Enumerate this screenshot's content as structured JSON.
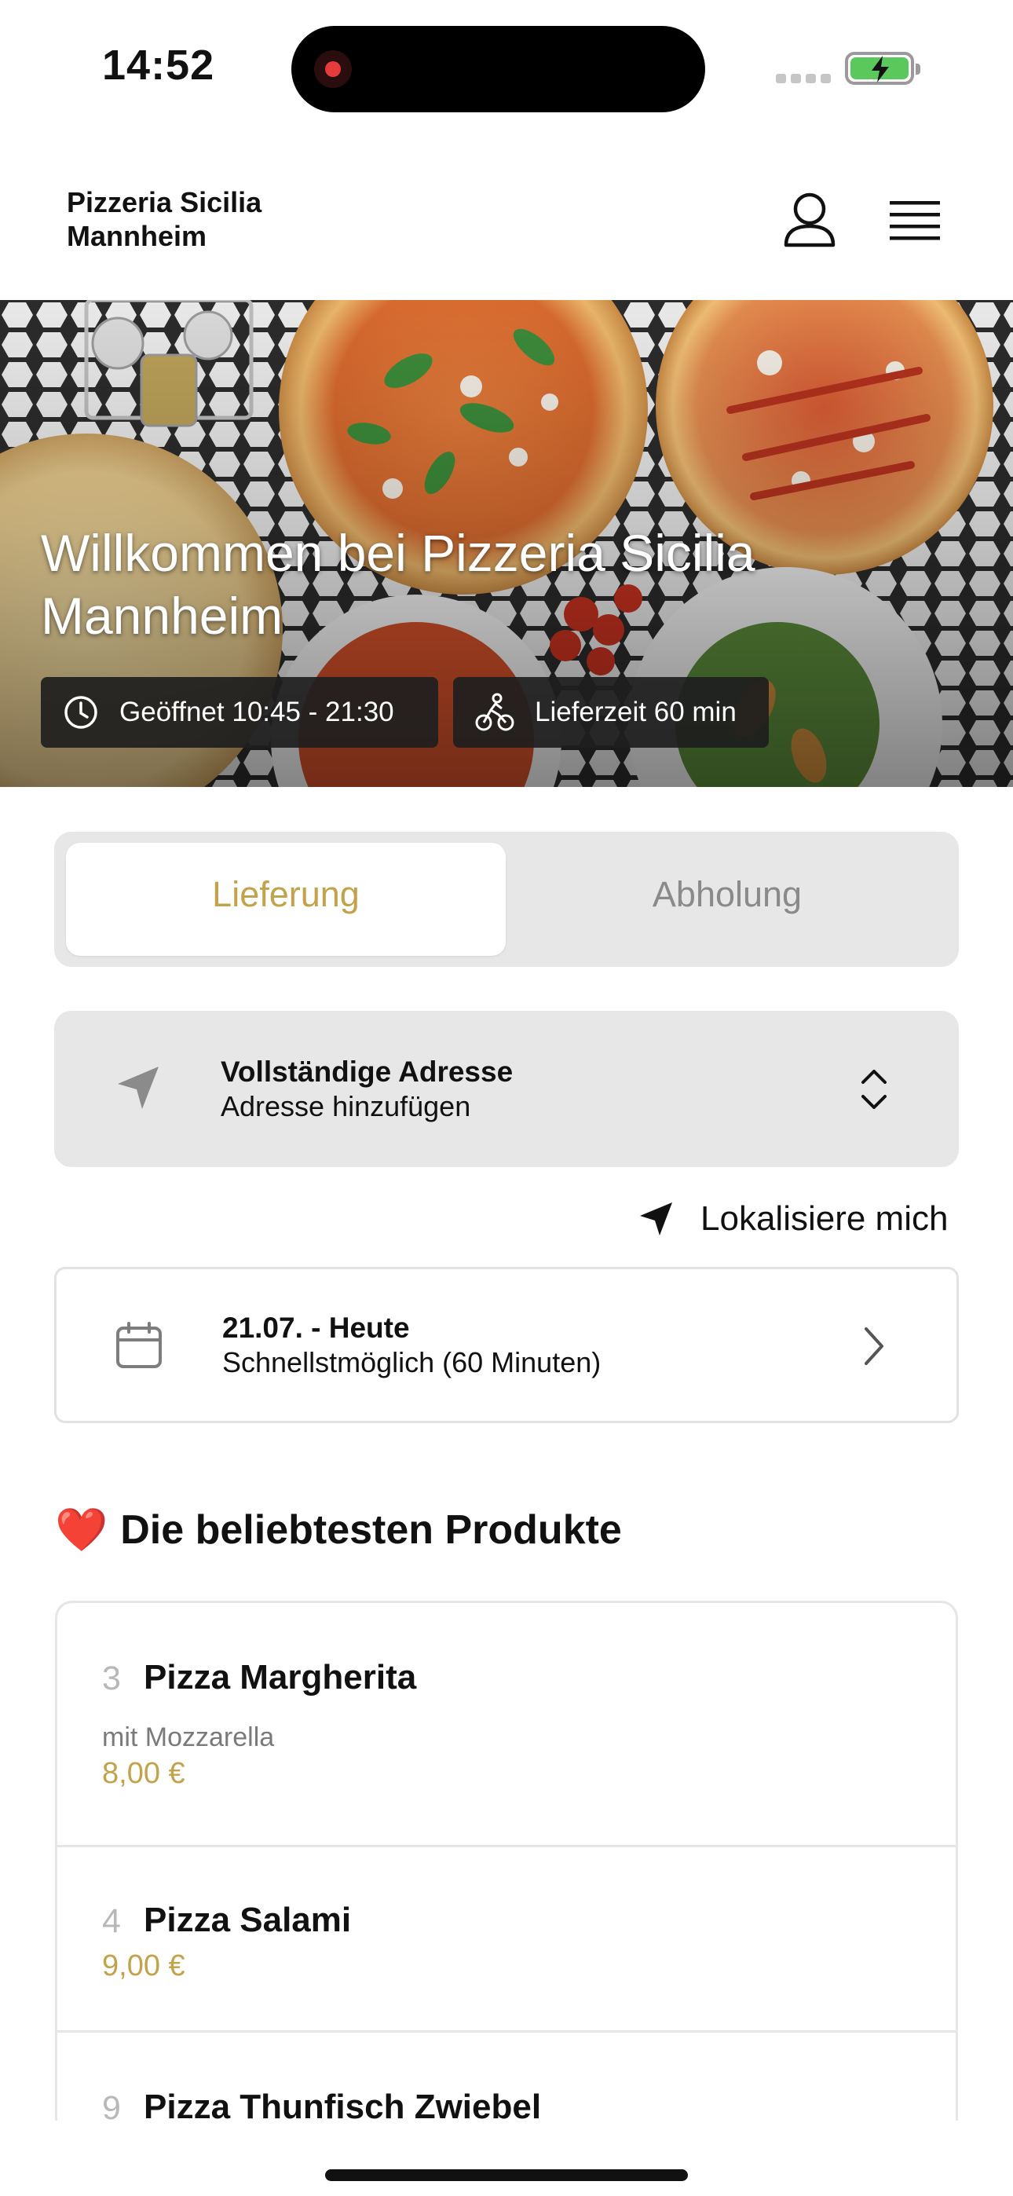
{
  "status_bar": {
    "time": "14:52"
  },
  "header": {
    "brand_line1": "Pizzeria Sicilia",
    "brand_line2": "Mannheim"
  },
  "hero": {
    "title": "Willkommen bei Pizzeria Sicilia Mannheim",
    "open_chip": "Geöffnet 10:45 - 21:30",
    "delivery_chip": "Lieferzeit 60 min"
  },
  "mode_toggle": {
    "delivery": "Lieferung",
    "pickup": "Abholung",
    "selected": "delivery"
  },
  "address": {
    "title": "Vollständige Adresse",
    "subtitle": "Adresse hinzufügen"
  },
  "locate_me": "Lokalisiere mich",
  "schedule": {
    "title": "21.07. - Heute",
    "subtitle": "Schnellstmöglich (60 Minuten)"
  },
  "popular": {
    "heading_emoji": "❤️",
    "heading": "Die beliebtesten Produkte",
    "items": [
      {
        "number": "3",
        "name": "Pizza Margherita",
        "description": "mit Mozzarella",
        "price": "8,00 €"
      },
      {
        "number": "4",
        "name": "Pizza Salami",
        "price": "9,00 €"
      },
      {
        "number": "9",
        "name": "Pizza Thunfisch Zwiebel"
      }
    ]
  },
  "colors": {
    "accent": "#c2a24a",
    "segment_bg": "#e7e7e7",
    "chip_bg": "#1e1e1e"
  }
}
